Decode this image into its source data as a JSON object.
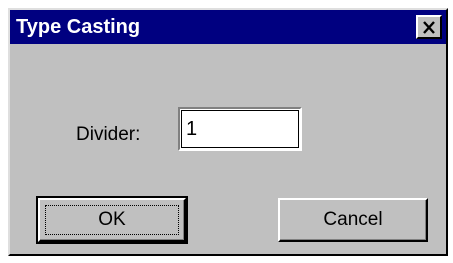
{
  "window": {
    "title": "Type Casting",
    "close_glyph": "✕"
  },
  "form": {
    "divider_label": "Divider:",
    "divider_value": "1"
  },
  "buttons": {
    "ok_label": "OK",
    "cancel_label": "Cancel"
  },
  "colors": {
    "titlebar": "#000080",
    "dialog_face": "#c0c0c0"
  },
  "icons": {
    "close": "close-icon"
  }
}
